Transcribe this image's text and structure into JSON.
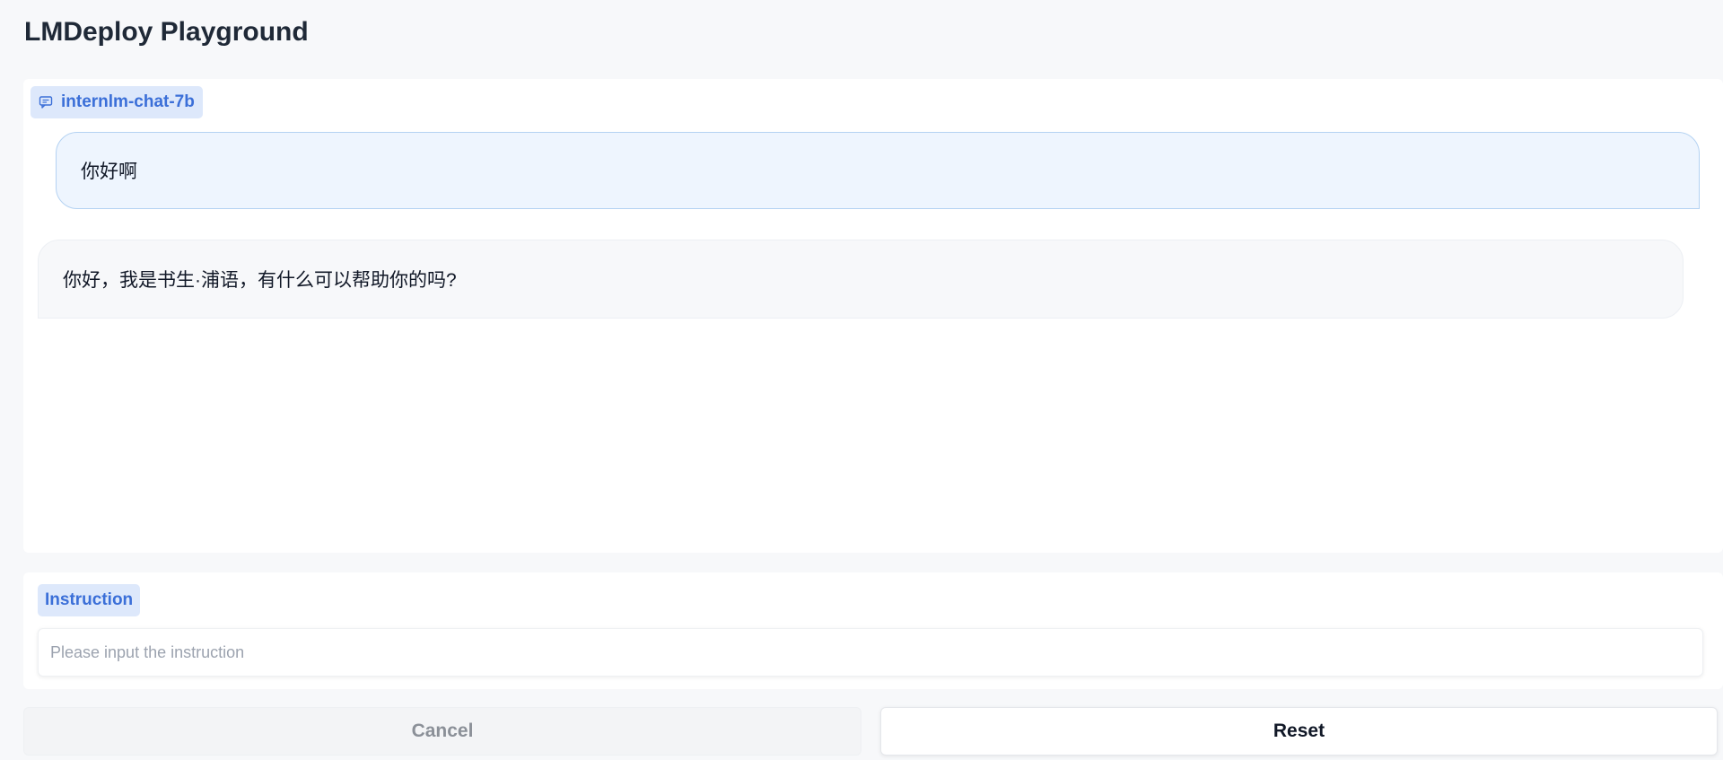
{
  "app": {
    "title": "LMDeploy Playground"
  },
  "chat": {
    "model_badge": {
      "label": "internlm-chat-7b",
      "icon": "chat-bubble-icon"
    },
    "messages": [
      {
        "role": "user",
        "text": "你好啊"
      },
      {
        "role": "assistant",
        "text": "你好，我是书生·浦语，有什么可以帮助你的吗?"
      }
    ]
  },
  "instruction": {
    "label": "Instruction",
    "value": "",
    "placeholder": "Please input the instruction"
  },
  "actions": {
    "cancel_label": "Cancel",
    "reset_label": "Reset"
  },
  "colors": {
    "accent": "#3b6fd8",
    "badge_bg": "#dde8fb",
    "user_bubble_bg": "#eef5fe",
    "user_bubble_border": "#b4d2f2",
    "bot_bubble_bg": "#f7f8fa",
    "page_bg": "#f7f8fa"
  }
}
